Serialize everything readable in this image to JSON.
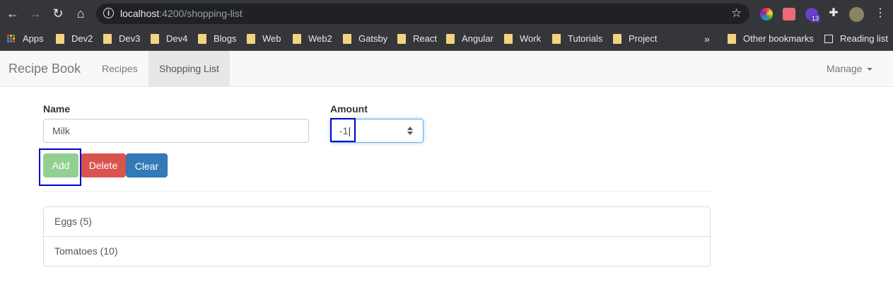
{
  "browser": {
    "url_host": "localhost",
    "url_rest": ":4200/shopping-list",
    "extension_badge": "13"
  },
  "bookmarks": {
    "apps": "Apps",
    "folders": [
      "Dev2",
      "Dev3",
      "Dev4",
      "Blogs",
      "Web",
      "Web2",
      "Gatsby",
      "React",
      "Angular",
      "Work",
      "Tutorials",
      "Project"
    ],
    "overflow": "»",
    "other": "Other bookmarks",
    "reading_list": "Reading list"
  },
  "navbar": {
    "brand": "Recipe Book",
    "links": [
      "Recipes",
      "Shopping List"
    ],
    "manage": "Manage"
  },
  "form": {
    "name_label": "Name",
    "name_value": "Milk",
    "amount_label": "Amount",
    "amount_value": "-1"
  },
  "buttons": {
    "add": "Add",
    "delete": "Delete",
    "clear": "Clear"
  },
  "shopping_list": [
    "Eggs (5)",
    "Tomatoes (10)"
  ],
  "colors": {
    "add": "#92d092",
    "delete": "#d9534f",
    "clear": "#337ab7",
    "highlight": "#0000cc"
  }
}
